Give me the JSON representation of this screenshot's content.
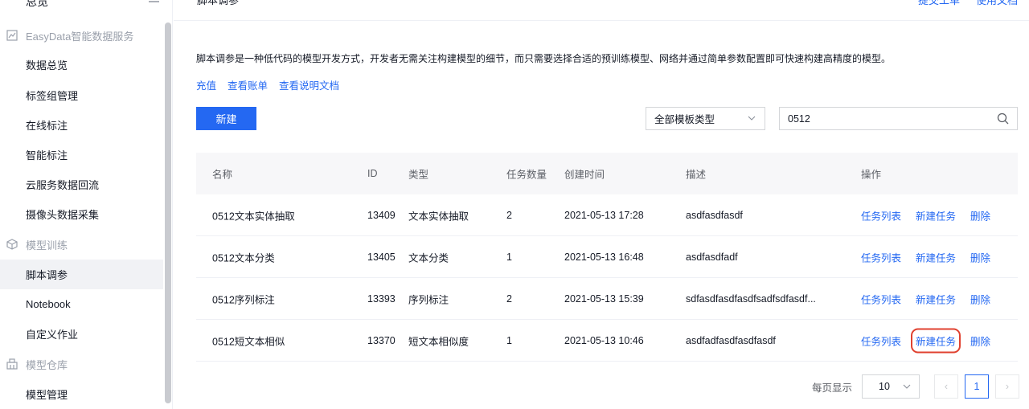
{
  "header": {
    "title": "脚本调参",
    "links": [
      "提交工单",
      "使用文档"
    ]
  },
  "sidebar": {
    "top_label": "总览",
    "groups": [
      {
        "label": "EasyData智能数据服务",
        "icon": "chart-icon"
      },
      {
        "label": "模型训练",
        "icon": "cube-icon"
      },
      {
        "label": "模型仓库",
        "icon": "warehouse-icon"
      }
    ],
    "items": [
      {
        "label": "数据总览"
      },
      {
        "label": "标签组管理"
      },
      {
        "label": "在线标注"
      },
      {
        "label": "智能标注"
      },
      {
        "label": "云服务数据回流"
      },
      {
        "label": "摄像头数据采集"
      },
      {
        "label": "脚本调参"
      },
      {
        "label": "Notebook"
      },
      {
        "label": "自定义作业"
      },
      {
        "label": "模型管理"
      }
    ]
  },
  "main": {
    "description": "脚本调参是一种低代码的模型开发方式，开发者无需关注构建模型的细节，而只需要选择合适的预训练模型、网络并通过简单参数配置即可快速构建高精度的模型。",
    "quick_links": [
      "充值",
      "查看账单",
      "查看说明文档"
    ],
    "new_button": "新建",
    "template_select": "全部模板类型",
    "search_value": "0512"
  },
  "table": {
    "headers": {
      "name": "名称",
      "id": "ID",
      "type": "类型",
      "count": "任务数量",
      "time": "创建时间",
      "desc": "描述",
      "ops": "操作"
    },
    "rows": [
      {
        "name": "0512文本实体抽取",
        "id": "13409",
        "type": "文本实体抽取",
        "count": "2",
        "time": "2021-05-13 17:28",
        "desc": "asdfasdfasdf"
      },
      {
        "name": "0512文本分类",
        "id": "13405",
        "type": "文本分类",
        "count": "1",
        "time": "2021-05-13 16:48",
        "desc": "asdfasdfadf"
      },
      {
        "name": "0512序列标注",
        "id": "13393",
        "type": "序列标注",
        "count": "2",
        "time": "2021-05-13 15:39",
        "desc": "sdfasdfasdfasdfsadfsdfasdf..."
      },
      {
        "name": "0512短文本相似",
        "id": "13370",
        "type": "短文本相似度",
        "count": "1",
        "time": "2021-05-13 10:46",
        "desc": "asdfadfasdfasdfasdf"
      }
    ],
    "ops": {
      "list": "任务列表",
      "new_task": "新建任务",
      "delete": "删除"
    }
  },
  "pagination": {
    "label": "每页显示",
    "page_size": "10",
    "current_page": "1",
    "prev": "‹",
    "next": "›"
  },
  "colors": {
    "accent": "#2468f2",
    "highlight": "#e0412f"
  }
}
